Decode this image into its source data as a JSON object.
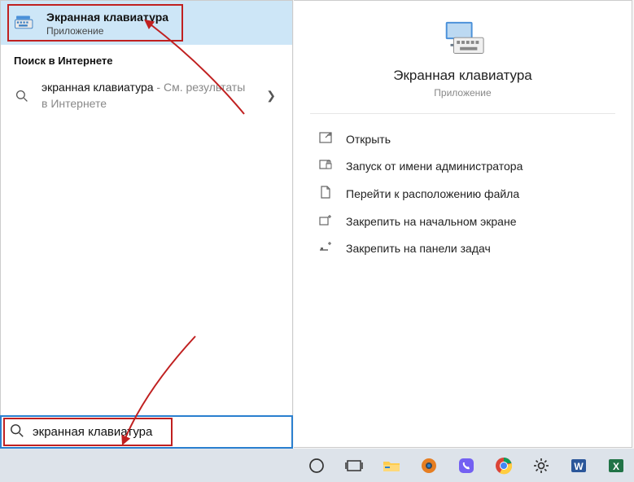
{
  "best_match": {
    "title": "Экранная клавиатура",
    "subtitle": "Приложение"
  },
  "web_section_header": "Поиск в Интернете",
  "web_result": {
    "query": "экранная клавиатура",
    "suggest": " - См. результаты в Интернете"
  },
  "preview": {
    "title": "Экранная клавиатура",
    "subtitle": "Приложение"
  },
  "actions": {
    "open": "Открыть",
    "run_admin": "Запуск от имени администратора",
    "open_location": "Перейти к расположению файла",
    "pin_start": "Закрепить на начальном экране",
    "pin_taskbar": "Закрепить на панели задач"
  },
  "search_value": "экранная клавиатура"
}
